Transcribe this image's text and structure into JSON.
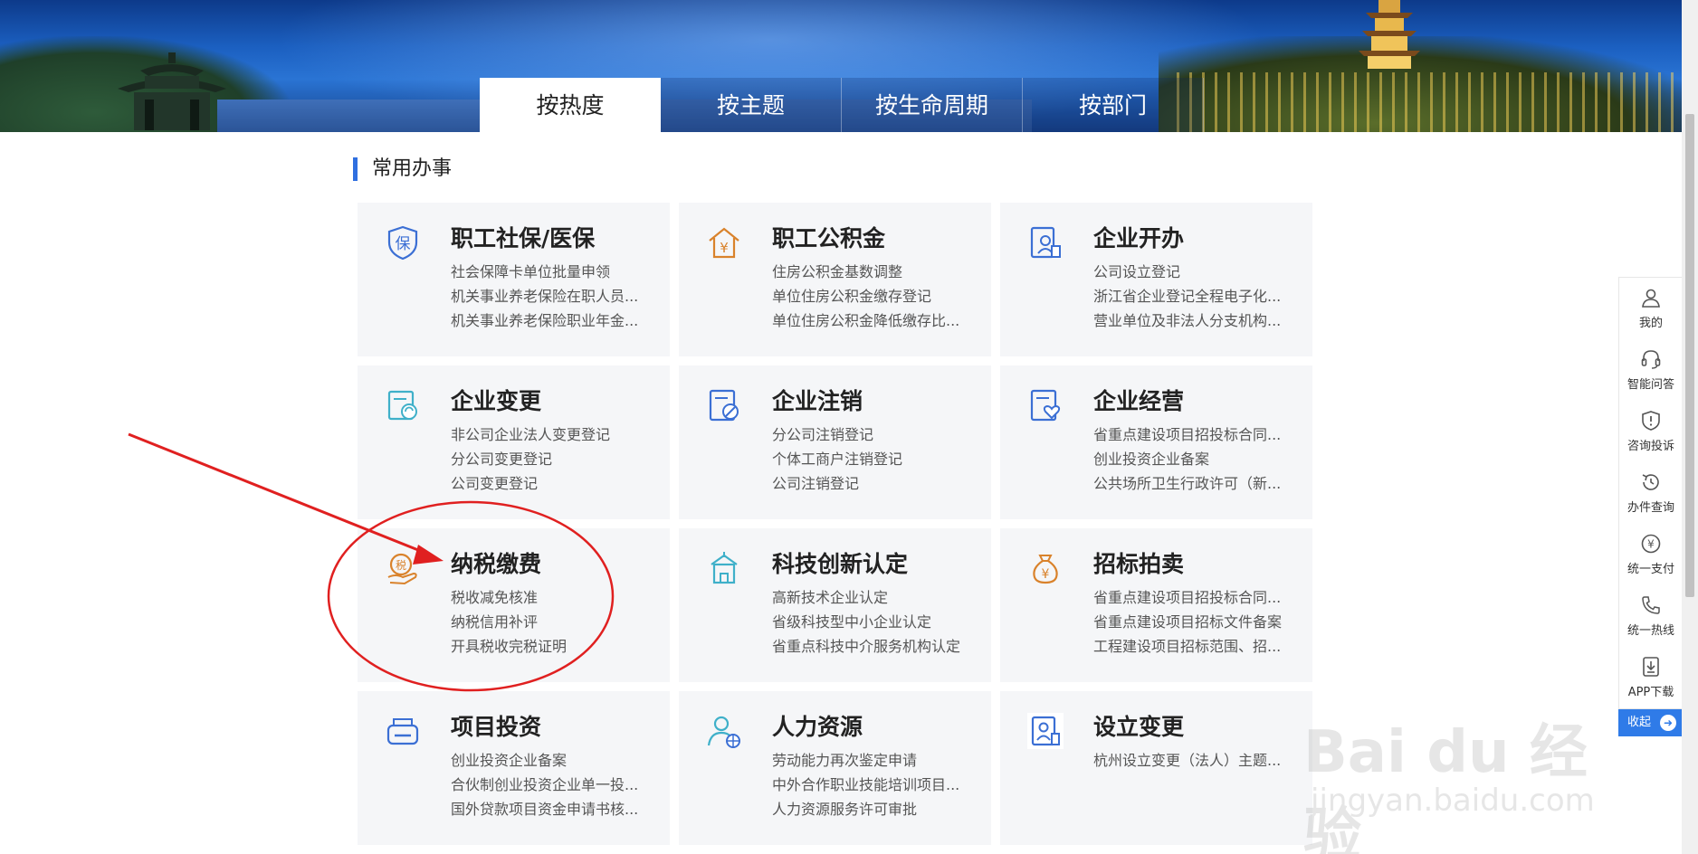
{
  "tabs": [
    {
      "label": "按热度",
      "active": true
    },
    {
      "label": "按主题",
      "active": false
    },
    {
      "label": "按生命周期",
      "active": false
    },
    {
      "label": "按部门",
      "active": false
    }
  ],
  "section_title": "常用办事",
  "cards": [
    {
      "name": "职工社保/医保",
      "icon": "shield-bao-icon",
      "color": "#3b6fd4",
      "links": [
        "社会保障卡单位批量申领",
        "机关事业养老保险在职人员...",
        "机关事业养老保险职业年金..."
      ]
    },
    {
      "name": "职工公积金",
      "icon": "house-yuan-icon",
      "color": "#d9822b",
      "links": [
        "住房公积金基数调整",
        "单位住房公积金缴存登记",
        "单位住房公积金降低缴存比..."
      ]
    },
    {
      "name": "企业开办",
      "icon": "company-register-icon",
      "color": "#3b6fd4",
      "links": [
        "公司设立登记",
        "浙江省企业登记全程电子化...",
        "营业单位及非法人分支机构..."
      ]
    },
    {
      "name": "企业变更",
      "icon": "document-refresh-icon",
      "color": "#3fb0c9",
      "links": [
        "非公司企业法人变更登记",
        "分公司变更登记",
        "公司变更登记"
      ]
    },
    {
      "name": "企业注销",
      "icon": "document-cancel-icon",
      "color": "#3b6fd4",
      "links": [
        "分公司注销登记",
        "个体工商户注销登记",
        "公司注销登记"
      ]
    },
    {
      "name": "企业经营",
      "icon": "document-heart-icon",
      "color": "#3b6fd4",
      "links": [
        "省重点建设项目招投标合同...",
        "创业投资企业备案",
        "公共场所卫生行政许可（新..."
      ]
    },
    {
      "name": "纳税缴费",
      "icon": "tax-hand-icon",
      "color": "#d9822b",
      "links": [
        "税收减免核准",
        "纳税信用补评",
        "开具税收完税证明"
      ]
    },
    {
      "name": "科技创新认定",
      "icon": "building-icon",
      "color": "#3fb0c9",
      "links": [
        "高新技术企业认定",
        "省级科技型中小企业认定",
        "省重点科技中介服务机构认定"
      ]
    },
    {
      "name": "招标拍卖",
      "icon": "money-bag-icon",
      "color": "#d9822b",
      "links": [
        "省重点建设项目招投标合同...",
        "省重点建设项目招标文件备案",
        "工程建设项目招标范围、招..."
      ]
    },
    {
      "name": "项目投资",
      "icon": "printer-box-icon",
      "color": "#3b6fd4",
      "links": [
        "创业投资企业备案",
        "合伙制创业投资企业单一投...",
        "国外贷款项目资金申请书核..."
      ]
    },
    {
      "name": "人力资源",
      "icon": "person-globe-icon",
      "color": "#3fb0c9",
      "links": [
        "劳动能力再次鉴定申请",
        "中外合作职业技能培训项目...",
        "人力资源服务许可审批"
      ]
    },
    {
      "name": "设立变更",
      "icon": "id-card-icon",
      "color": "#3b6fd4",
      "links": [
        "杭州设立变更（法人）主题..."
      ]
    }
  ],
  "floatbar": [
    {
      "label": "我的",
      "icon": "user-icon"
    },
    {
      "label": "智能问答",
      "icon": "headset-icon"
    },
    {
      "label": "咨询投诉",
      "icon": "alert-shield-icon"
    },
    {
      "label": "办件查询",
      "icon": "history-icon"
    },
    {
      "label": "统一支付",
      "icon": "yuan-icon"
    },
    {
      "label": "统一热线",
      "icon": "phone-icon"
    },
    {
      "label": "APP下载",
      "icon": "download-icon"
    }
  ],
  "collapse_label": "收起",
  "watermark": {
    "main": "Bai du 经验",
    "sub": "jingyan.baidu.com"
  }
}
